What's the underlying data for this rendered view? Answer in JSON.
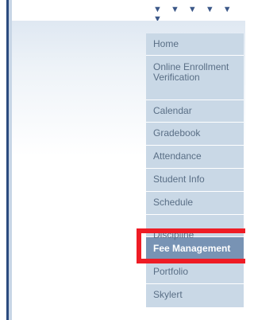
{
  "header": {
    "logo_text": "▼ ▼ ▼ ▼ ▼ ▼"
  },
  "menu": {
    "items": [
      {
        "label": "Home"
      },
      {
        "label": "Online Enrollment Verification"
      },
      {
        "label": "Calendar"
      },
      {
        "label": "Gradebook"
      },
      {
        "label": "Attendance"
      },
      {
        "label": "Student Info"
      },
      {
        "label": "Schedule"
      },
      {
        "label": "Discipline"
      },
      {
        "label": "Fee Management"
      },
      {
        "label": "Portfolio"
      },
      {
        "label": "Skylert"
      }
    ],
    "active_label": "Fee Management"
  },
  "colors": {
    "menu_bg": "#c9d8e6",
    "menu_text": "#5a6f86",
    "active_bg": "#7893b4",
    "highlight": "#ee1c25"
  }
}
